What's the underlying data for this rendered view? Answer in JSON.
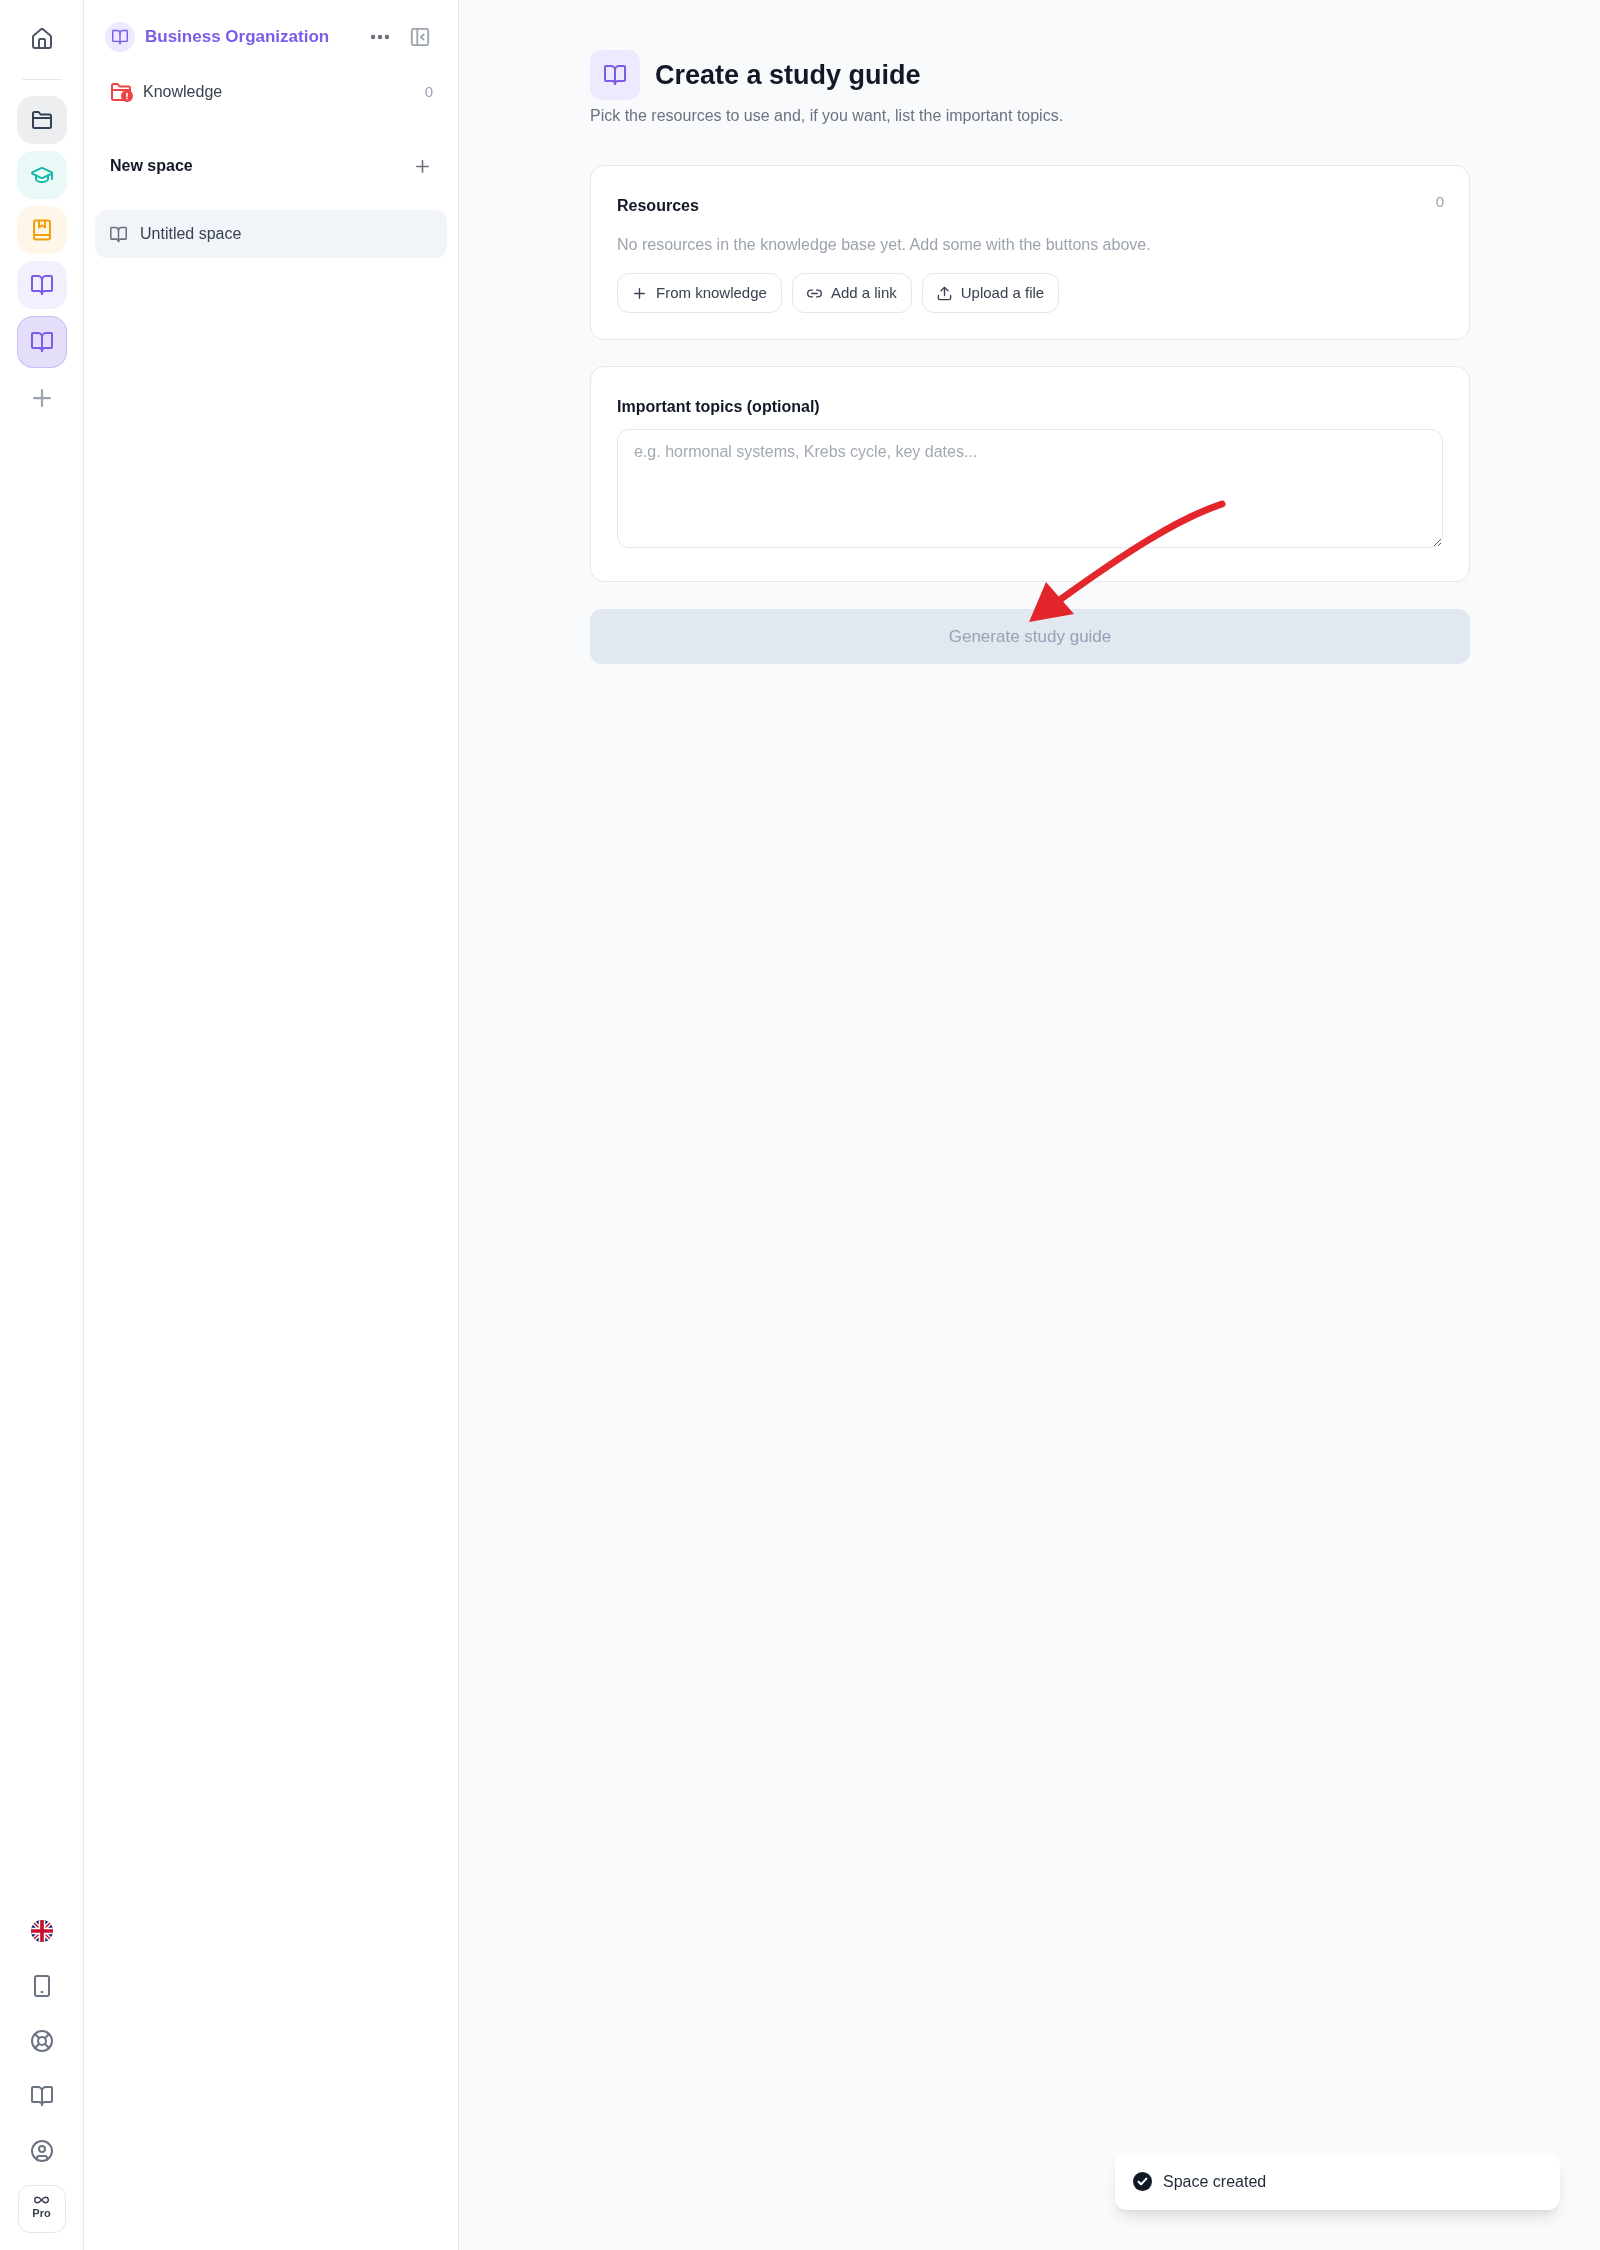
{
  "rail": {
    "spaces": [
      {
        "kind": "folder",
        "color": "#334155",
        "selected": false
      },
      {
        "kind": "course",
        "color": "#14b8a6",
        "selected": false
      },
      {
        "kind": "notebook",
        "color": "#f59e0b",
        "selected": false
      },
      {
        "kind": "book",
        "color": "#7c5ce6",
        "selected": false
      },
      {
        "kind": "book",
        "color": "#7c5ce6",
        "selected": true
      }
    ],
    "pro_label": "Pro"
  },
  "sidebar": {
    "title": "Business Organization",
    "knowledge": {
      "label": "Knowledge",
      "count": "0",
      "alert": true
    },
    "section_title": "New space",
    "spaces": [
      {
        "label": "Untitled space",
        "selected": true
      }
    ]
  },
  "main": {
    "title": "Create a study guide",
    "subtitle": "Pick the resources to use and, if you want, list the important topics.",
    "resources": {
      "title": "Resources",
      "count": "0",
      "empty_text": "No resources in the knowledge base yet. Add some with the buttons above.",
      "buttons": [
        {
          "kind": "add",
          "label": "From knowledge"
        },
        {
          "kind": "link",
          "label": "Add a link"
        },
        {
          "kind": "upload",
          "label": "Upload a file"
        }
      ]
    },
    "topics": {
      "label": "Important topics (optional)",
      "placeholder": "e.g. hormonal systems, Krebs cycle, key dates..."
    },
    "generate_button": {
      "label": "Generate study guide",
      "disabled": true
    }
  },
  "toast": {
    "message": "Space created"
  }
}
